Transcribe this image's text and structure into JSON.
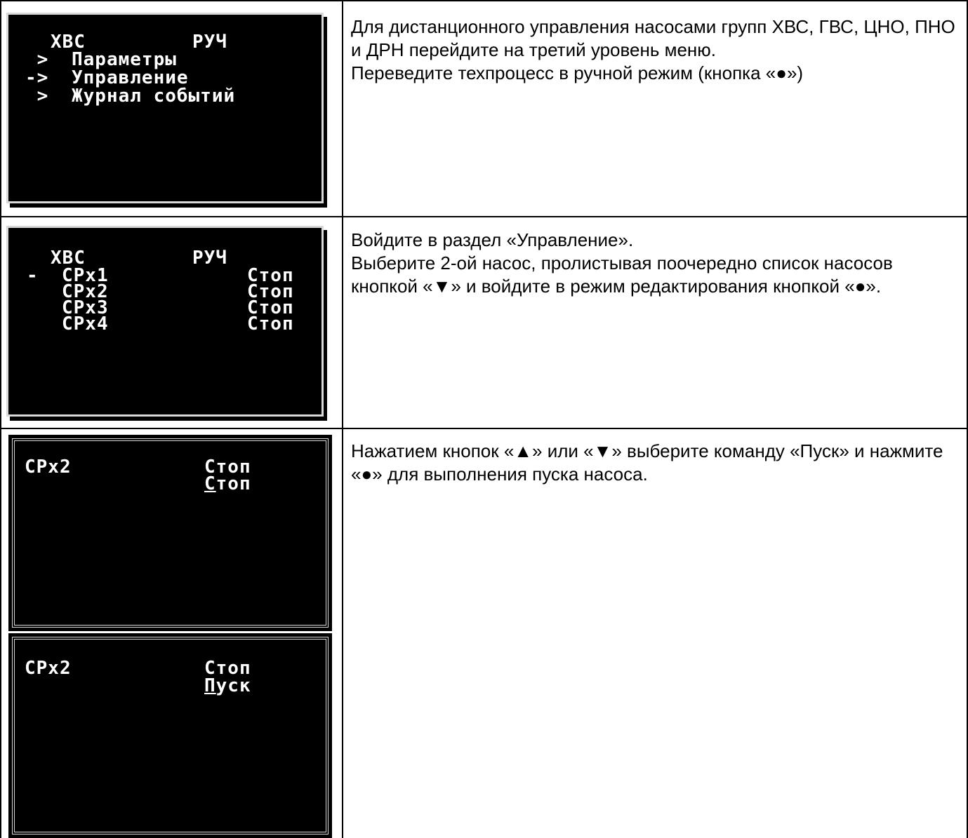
{
  "row1": {
    "screen": {
      "title": "ХВС",
      "mode": "РУЧ",
      "menu": [
        {
          "marker": " >",
          "label": "Параметры"
        },
        {
          "marker": "->",
          "label": "Управление"
        },
        {
          "marker": " >",
          "label": "Журнал событий"
        }
      ]
    },
    "text": [
      "Для дистанционного управления насосами групп ХВС, ГВС, ЦНО, ПНО и ДРН перейдите на третий уровень меню.",
      "Переведите техпроцесс в ручной режим (кнопка «●»)"
    ]
  },
  "row2": {
    "screen": {
      "title": "ХВС",
      "mode": "РУЧ",
      "cursor": "-",
      "pumps": [
        {
          "name": "CPx1",
          "state": "Стоп"
        },
        {
          "name": "CPx2",
          "state": "Стоп"
        },
        {
          "name": "CPx3",
          "state": "Стоп"
        },
        {
          "name": "CPx4",
          "state": "Стоп"
        }
      ]
    },
    "text": [
      "Войдите в раздел «Управление».",
      "Выберите 2-ой насос, пролистывая поочередно список насосов кнопкой «▼» и войдите в режим редактирования кнопкой «●»."
    ]
  },
  "row3": {
    "screen1": {
      "name": "CPx2",
      "state": "Стоп",
      "edit_first": "С",
      "edit_rest": "топ"
    },
    "screen2": {
      "name": "CPx2",
      "state": "Стоп",
      "edit_first": "П",
      "edit_rest": "уск"
    },
    "text": [
      "Нажатием кнопок «▲» или «▼» выберите команду «Пуск» и нажмите «●» для выполнения пуска насоса."
    ]
  }
}
